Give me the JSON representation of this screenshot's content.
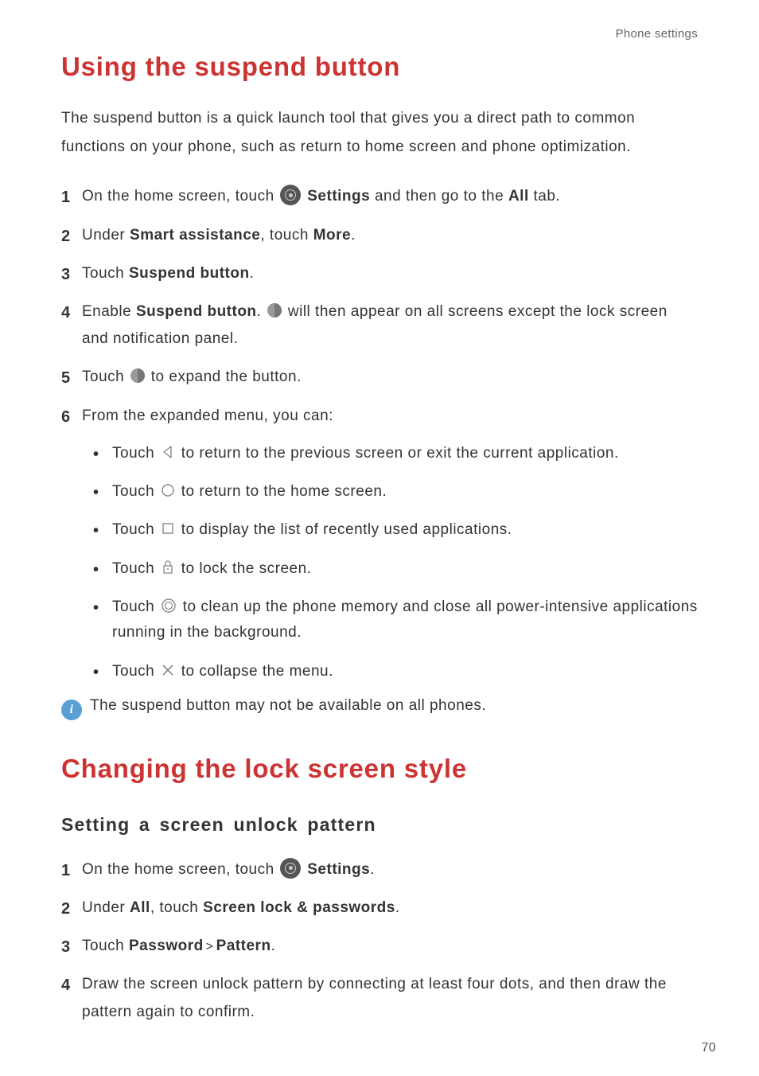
{
  "breadcrumb": "Phone settings",
  "heading1": "Using the suspend button",
  "intro": "The suspend button is a quick launch tool that gives you a direct path to common functions on your phone, such as return to home screen and phone optimization.",
  "step1": {
    "pre": "On the home screen, touch ",
    "label": "Settings",
    "mid": " and then go to the ",
    "tab": "All",
    "post": " tab."
  },
  "step2": {
    "pre": "Under ",
    "b1": "Smart assistance",
    "mid": ", touch ",
    "b2": "More",
    "post": "."
  },
  "step3": {
    "pre": "Touch ",
    "b1": "Suspend button",
    "post": "."
  },
  "step4": {
    "pre": "Enable ",
    "b1": "Suspend button",
    "mid": ". ",
    "post": " will then appear on all screens except the lock screen and notification panel."
  },
  "step5": {
    "pre": "Touch ",
    "post": " to expand the button."
  },
  "step6": {
    "intro": "From the expanded menu, you can:",
    "bullets": {
      "b1": {
        "pre": "Touch ",
        "post": " to return to the previous screen or exit the current application."
      },
      "b2": {
        "pre": "Touch ",
        "post": " to return to the home screen."
      },
      "b3": {
        "pre": "Touch ",
        "post": " to display the list of recently used applications."
      },
      "b4": {
        "pre": "Touch ",
        "post": " to lock the screen."
      },
      "b5": {
        "pre": "Touch ",
        "post": " to clean up the phone memory and close all power-intensive applications running in the background."
      },
      "b6": {
        "pre": "Touch ",
        "post": " to collapse the menu."
      }
    }
  },
  "note": "The suspend button may not be available on all phones.",
  "heading2": "Changing the lock screen style",
  "subheading": "Setting a screen unlock pattern",
  "sec2": {
    "s1": {
      "pre": "On the home screen, touch ",
      "label": "Settings",
      "post": "."
    },
    "s2": {
      "pre": "Under ",
      "b1": "All",
      "mid": ", touch ",
      "b2": "Screen lock & passwords",
      "post": "."
    },
    "s3": {
      "pre": "Touch ",
      "b1": "Password",
      "gt": ">",
      "b2": "Pattern",
      "post": "."
    },
    "s4": "Draw the screen unlock pattern by connecting at least four dots, and then draw the pattern again to confirm."
  },
  "pageNum": "70",
  "infoGlyph": "i"
}
